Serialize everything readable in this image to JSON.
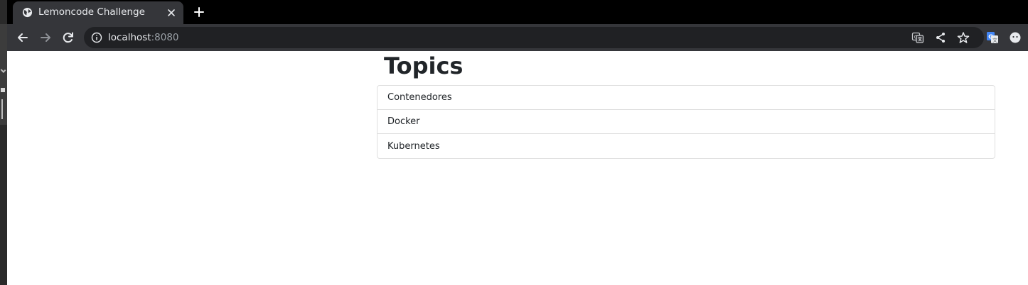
{
  "browser": {
    "tab": {
      "title": "Lemoncode Challenge"
    },
    "address_bar": {
      "host": "localhost",
      "port": ":8080"
    },
    "icons": {
      "favicon": "globe-icon",
      "close": "close-icon",
      "new_tab": "plus-icon",
      "back": "arrow-left-icon",
      "forward": "arrow-right-icon",
      "reload": "reload-icon",
      "info": "info-icon",
      "translate": "translate-icon",
      "share": "share-icon",
      "bookmark": "star-icon",
      "extension": "google-translate-extension-icon",
      "profile": "profile-icon"
    }
  },
  "page": {
    "heading": "Topics",
    "topics": [
      "Contenedores",
      "Docker",
      "Kubernetes"
    ]
  },
  "colors": {
    "titlebar": "#000000",
    "toolbar": "#35363a",
    "omnibox": "#202124",
    "page_background": "#ffffff",
    "text": "#212529",
    "list_border": "#dfdfdf"
  }
}
